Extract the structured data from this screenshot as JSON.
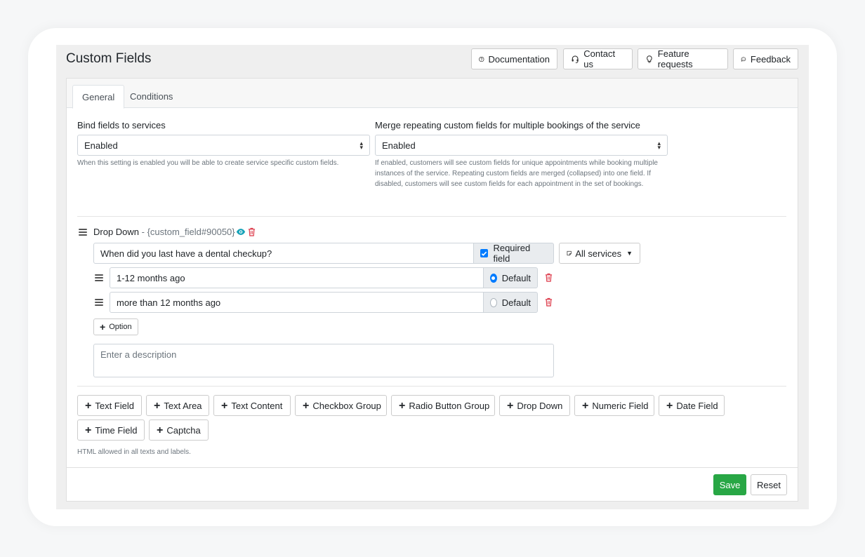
{
  "page": {
    "title": "Custom Fields"
  },
  "header_buttons": {
    "documentation": "Documentation",
    "contact": "Contact us",
    "feature_requests": "Feature requests",
    "feedback": "Feedback"
  },
  "tabs": {
    "general": "General",
    "conditions": "Conditions"
  },
  "settings": {
    "bind": {
      "label": "Bind fields to services",
      "value": "Enabled",
      "help": "When this setting is enabled you will be able to create service specific custom fields."
    },
    "merge": {
      "label": "Merge repeating custom fields for multiple bookings of the service",
      "value": "Enabled",
      "help": "If enabled, customers will see custom fields for unique appointments while booking multiple instances of the service. Repeating custom fields are merged (collapsed) into one field. If disabled, customers will see custom fields for each appointment in the set of bookings."
    }
  },
  "field": {
    "type": "Drop Down",
    "code": " - {custom_field#90050}",
    "question": "When did you last have a dental checkup?",
    "required_label": "Required field",
    "required_checked": true,
    "services_label": "All services",
    "options": [
      {
        "value": "1-12 months ago",
        "default_label": "Default",
        "is_default": true
      },
      {
        "value": "more than 12 months ago",
        "default_label": "Default",
        "is_default": false
      }
    ],
    "add_option_label": "Option",
    "description_placeholder": "Enter a description"
  },
  "add_buttons": {
    "text_field": "Text Field",
    "text_area": "Text Area",
    "text_content": "Text Content",
    "checkbox_group": "Checkbox Group",
    "radio_button_group": "Radio Button Group",
    "drop_down": "Drop Down",
    "numeric_field": "Numeric Field",
    "date_field": "Date Field",
    "time_field": "Time Field",
    "captcha": "Captcha"
  },
  "html_note": "HTML allowed in all texts and labels.",
  "footer": {
    "save": "Save",
    "reset": "Reset"
  },
  "colors": {
    "accent": "#007bff",
    "success": "#28a745",
    "danger": "#dc3545",
    "eye": "#17a2b8"
  }
}
